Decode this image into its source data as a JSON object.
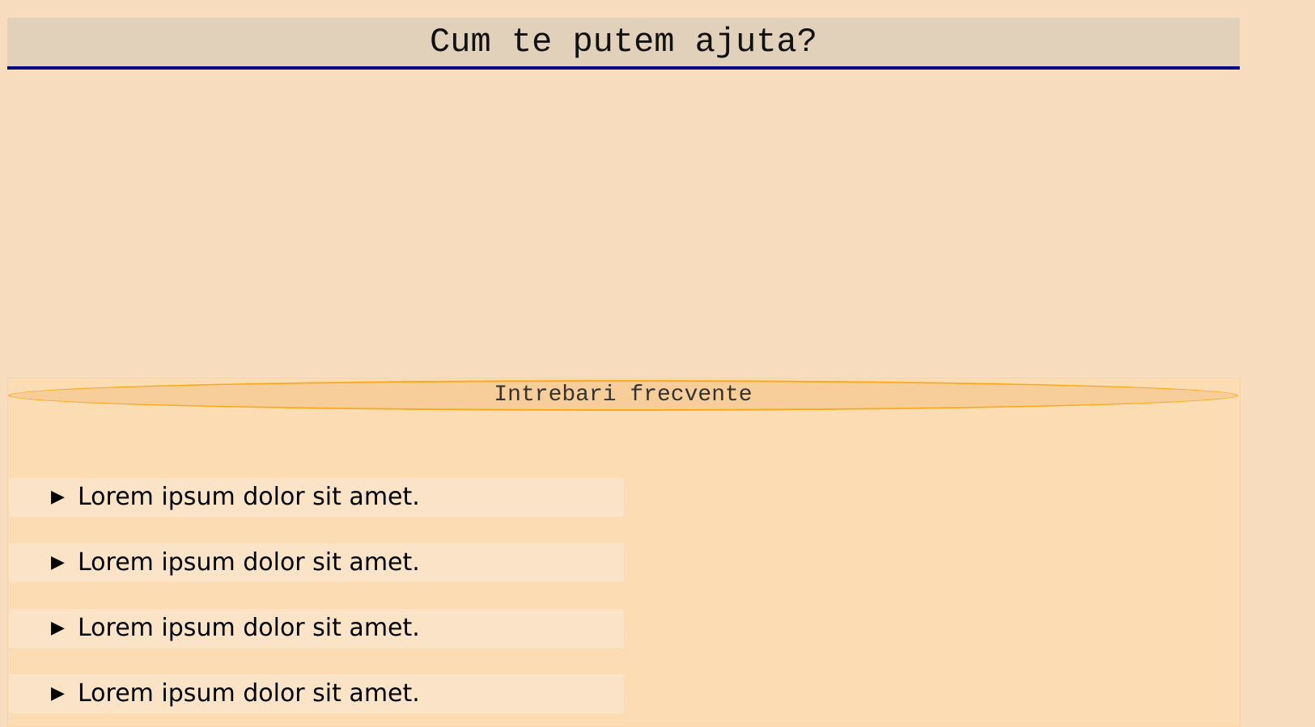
{
  "header": {
    "title": "Cum te putem ajuta?"
  },
  "faq": {
    "title": "Intrebari frecvente",
    "items": [
      {
        "label": "Lorem ipsum dolor sit amet."
      },
      {
        "label": "Lorem ipsum dolor sit amet."
      },
      {
        "label": "Lorem ipsum dolor sit amet."
      },
      {
        "label": "Lorem ipsum dolor sit amet."
      }
    ],
    "arrow": "▶"
  }
}
